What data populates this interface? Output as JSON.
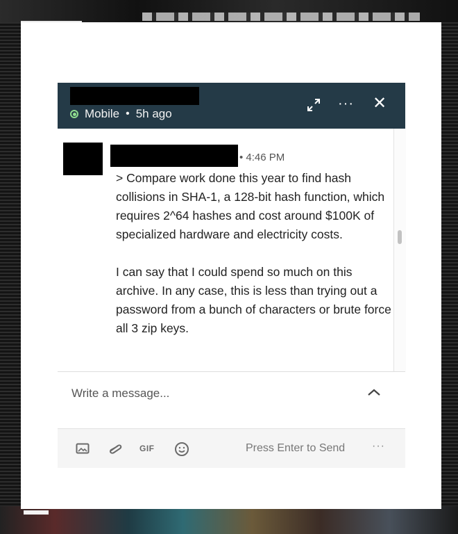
{
  "header": {
    "status": "Mobile",
    "separator": "•",
    "last_seen": "5h ago",
    "more_label": "···",
    "close_label": "✕"
  },
  "message": {
    "time": "• 4:46 PM",
    "paragraphs": [
      "> Compare work done this year to find hash collisions in SHA-1, a 128-bit hash function, which requires 2^64 hashes and cost around $100K of specialized hardware and electricity costs.",
      "I can say that I could spend so much on this archive. In any case, this is less than trying out a password from a bunch of characters or brute force all 3 zip keys."
    ]
  },
  "composer": {
    "placeholder": "Write a message...",
    "value": ""
  },
  "toolbar": {
    "gif_label": "GIF",
    "send_hint": "Press Enter to Send",
    "more_label": "···"
  },
  "icons": {
    "status": "online-status-icon",
    "expand": "expand-icon",
    "close": "close-icon",
    "collapse": "chevron-up-icon",
    "photo": "image-icon",
    "attach": "paperclip-icon",
    "emoji": "emoji-icon"
  },
  "colors": {
    "header_bg": "#243a47",
    "status_green": "#8fdc8f",
    "text": "#222222"
  }
}
